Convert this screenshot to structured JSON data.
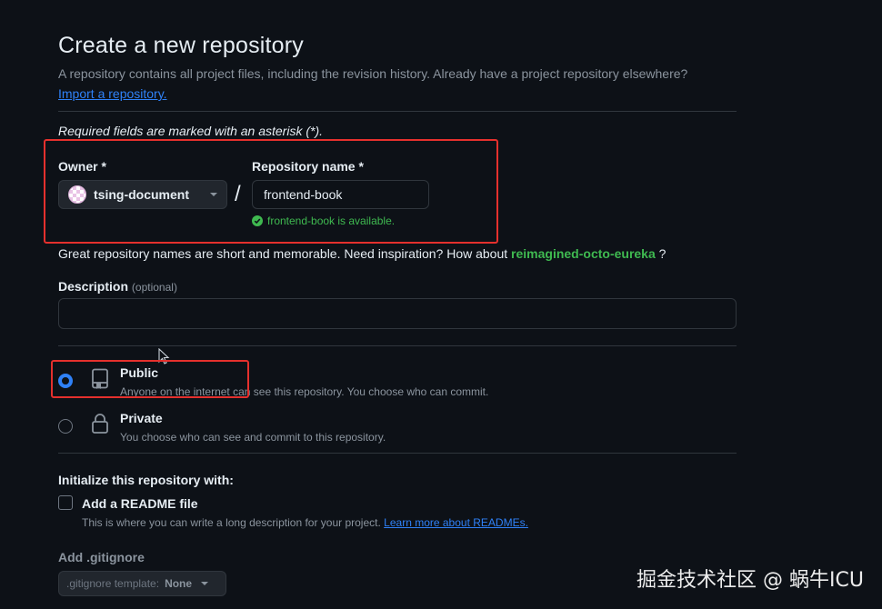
{
  "page": {
    "title": "Create a new repository",
    "description": "A repository contains all project files, including the revision history. Already have a project repository elsewhere?",
    "import_link": "Import a repository.",
    "required_note": "Required fields are marked with an asterisk (*)."
  },
  "owner": {
    "label": "Owner *",
    "value": "tsing-document",
    "icon": "avatar"
  },
  "separator": "/",
  "repo_name": {
    "label": "Repository name *",
    "value": "frontend-book",
    "availability": "frontend-book is available."
  },
  "suggestion": {
    "text": "Great repository names are short and memorable. Need inspiration? How about",
    "name": "reimagined-octo-eureka",
    "tail": "?"
  },
  "description_field": {
    "label": "Description",
    "optional": "(optional)",
    "value": ""
  },
  "visibility": [
    {
      "title": "Public",
      "desc": "Anyone on the internet can see this repository. You choose who can commit.",
      "icon": "repo-icon",
      "selected": true
    },
    {
      "title": "Private",
      "desc": "You choose who can see and commit to this repository.",
      "icon": "lock-icon",
      "selected": false
    }
  ],
  "initialize": {
    "heading": "Initialize this repository with:",
    "readme_label": "Add a README file",
    "readme_desc": "This is where you can write a long description for your project.",
    "readme_link": "Learn more about READMEs.",
    "readme_checked": false
  },
  "gitignore": {
    "label": "Add .gitignore",
    "prefix": ".gitignore template:",
    "value": "None"
  },
  "watermark": "掘金技术社区 @ 蜗牛ICU",
  "colors": {
    "background": "#0d1117",
    "accent_blue": "#2f81f7",
    "success_green": "#3fb950",
    "highlight_red": "#e5302d"
  }
}
